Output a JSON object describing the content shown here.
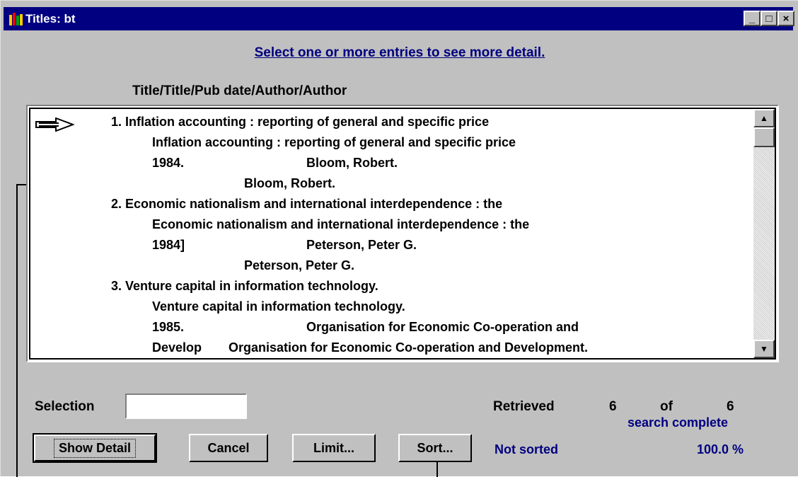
{
  "window": {
    "title": "Titles: bt",
    "controls": {
      "minimize": "_",
      "maximize": "□",
      "close": "×"
    }
  },
  "hint": "Select one or more entries to see more detail.",
  "column_header": "Title/Title/Pub date/Author/Author",
  "entries": [
    {
      "line1": "1. Inflation accounting : reporting of general and specific price",
      "line2": "Inflation accounting : reporting of general and specific price",
      "line3_date": "1984.",
      "line3_author": "Bloom, Robert.",
      "line4": "Bloom, Robert."
    },
    {
      "line1": "2. Economic nationalism and international interdependence : the",
      "line2": "Economic nationalism and international interdependence : the",
      "line3_date": "1984]",
      "line3_author": "Peterson, Peter G.",
      "line4": "Peterson, Peter G."
    },
    {
      "line1": "3. Venture capital in information technology.",
      "line2": "Venture capital in information technology.",
      "line3_date": "1985.",
      "line3_author": "Organisation for Economic Co-operation and",
      "line4_left": "Develop",
      "line4": "Organisation for Economic Co-operation and Development."
    }
  ],
  "selection_label": "Selection",
  "selection_value": "",
  "retrieved": {
    "label": "Retrieved",
    "count": "6",
    "of_label": "of",
    "total": "6"
  },
  "search_status": "search complete",
  "sort_status": "Not sorted",
  "percent": "100.0 %",
  "buttons": {
    "show_detail": "Show Detail",
    "cancel": "Cancel",
    "limit": "Limit...",
    "sort": "Sort..."
  },
  "icons": {
    "app": "books-icon",
    "pointer": "arrow-right-icon",
    "scroll_up": "▲",
    "scroll_down": "▼"
  }
}
